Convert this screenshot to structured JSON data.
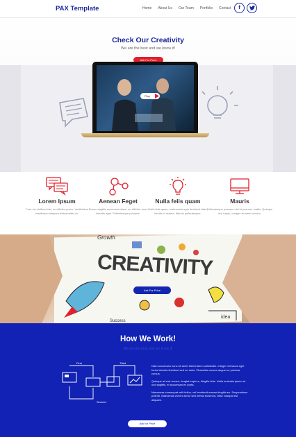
{
  "header": {
    "logo": "PAX Template",
    "nav": [
      "Home",
      "About Us",
      "Our Team",
      "Portfolio",
      "Contact"
    ],
    "social": [
      {
        "icon": "facebook-icon",
        "glyph": "f"
      },
      {
        "icon": "twitter-icon",
        "glyph": "t"
      }
    ]
  },
  "hero": {
    "title": "Check Our Creativity",
    "subtitle": "We are the best and we know it!",
    "button": "Ask For Price",
    "play_label": "Play"
  },
  "features": [
    {
      "icon": "chat-icon",
      "title": "Lorem Ipsum",
      "text": "Cras vel eleifend nisl, ac efficitur purus. Vestibulum vestibulum aliquam lectusmattis ac."
    },
    {
      "icon": "network-icon",
      "title": "Aenean Feget",
      "text": "Donec sagittis accumsan diam, eu efficitur nunc lobortis eget. Pellentesque posuere."
    },
    {
      "icon": "lightbulb-icon",
      "title": "Nulla felis quam",
      "text": "Nulla felis quam, malesuada quis tincidunt vitae, iaculis id massa. Mauris pellentesque."
    },
    {
      "icon": "monitor-icon",
      "title": "Mauris",
      "text": "Pellentesque posuere nisl id posuere mattis. Quisque nisl turpis, congue sit amet viverra."
    }
  ],
  "creativity": {
    "word": "CREATIVITY",
    "button": "Ask For Price",
    "doodles": [
      "Growth",
      "idea",
      "Success"
    ]
  },
  "how": {
    "title": "How We Work!",
    "subtitle": "We are the best and we know it!",
    "steps": [
      "First",
      "Third",
      "Second"
    ],
    "paragraphs": [
      "Nam accumsan nunc sit amet elementum sollicitudin. Integer vel lacus eget tortor lobortis tincidunt sed eu dolor. Phasellus cursus augue eu pulvinar cursus.",
      "Quisque at erat ornare, feugiat turpis a, fringilla felis. Nulla molestie ipsum et orci sagittis, et accumsan ex porta.",
      "Maecenas consequat velit tellus, vel hendrerit massa fringilla eu. Suspendisse potenti. Maecenas viverra tortor sed metus euismod, vitae volutpat est aliquam."
    ],
    "button": "Ask for Price"
  },
  "colors": {
    "brand": "#1a2a9a",
    "accent": "#e0202a",
    "how_bg": "#1222b4"
  }
}
